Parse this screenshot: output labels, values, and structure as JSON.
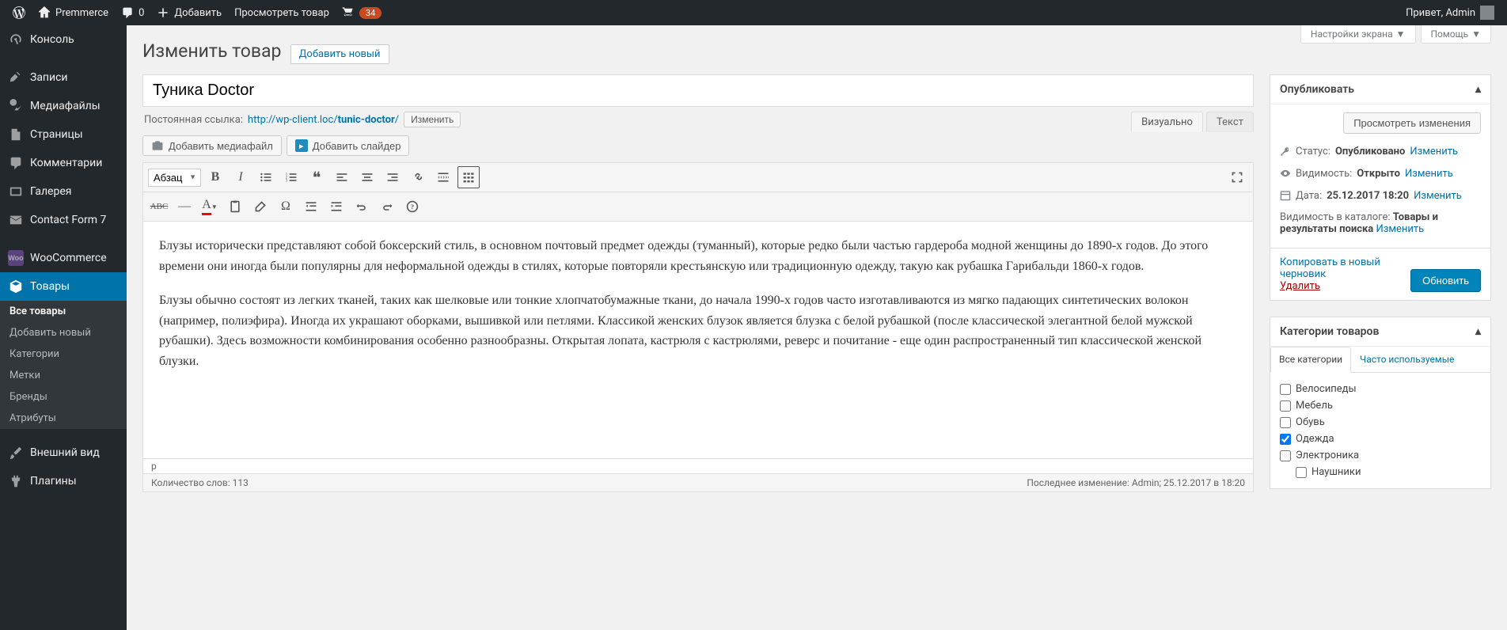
{
  "adminbar": {
    "site_name": "Premmerce",
    "comments_count": "0",
    "add_new": "Добавить",
    "view_item": "Просмотреть товар",
    "updates_count": "34",
    "greeting": "Привет, Admin"
  },
  "screen_options": "Настройки экрана",
  "help": "Помощь",
  "sidebar": {
    "items": [
      {
        "label": "Консоль"
      },
      {
        "label": "Записи"
      },
      {
        "label": "Медиафайлы"
      },
      {
        "label": "Страницы"
      },
      {
        "label": "Комментарии"
      },
      {
        "label": "Галерея"
      },
      {
        "label": "Contact Form 7"
      },
      {
        "label": "WooCommerce"
      },
      {
        "label": "Товары"
      },
      {
        "label": "Внешний вид"
      },
      {
        "label": "Плагины"
      }
    ],
    "submenu": [
      "Все товары",
      "Добавить новый",
      "Категории",
      "Метки",
      "Бренды",
      "Атрибуты"
    ]
  },
  "page": {
    "title": "Изменить товар",
    "add_new": "Добавить новый"
  },
  "post": {
    "title": "Туника Doctor",
    "permalink_label": "Постоянная ссылка:",
    "permalink_base": "http://wp-client.loc/",
    "permalink_slug": "tunic-doctor",
    "permalink_trail": "/",
    "edit": "Изменить",
    "add_media": "Добавить медиафайл",
    "add_slider": "Добавить слайдер",
    "tab_visual": "Визуально",
    "tab_text": "Текст",
    "format_select": "Абзац",
    "body_p1": "Блузы исторически представляют собой боксерский стиль, в основном почтовый предмет одежды (туманный), которые редко были частью гардероба модной женщины до 1890-х годов. До этого времени они иногда были популярны для неформальной одежды в стилях, которые повторяли крестьянскую или традиционную одежду, такую как рубашка Гарибальди 1860-х годов.",
    "body_p2": "Блузы обычно состоят из легких тканей, таких как шелковые или тонкие хлопчатобумажные ткани, до начала 1990-х годов часто изготавливаются из мягко падающих синтетических волокон (например, полиэфира). Иногда их украшают оборками, вышивкой или петлями. Классикой женских блузок является блузка с белой рубашкой (после классической элегантной белой мужской рубашки). Здесь возможности комбинирования особенно разнообразны. Открытая лопата, кастрюля с кастрюлями, реверс и почитание - еще один распространенный тип классической женской блузки.",
    "path": "p",
    "word_count_label": "Количество слов:",
    "word_count": "113",
    "last_edit_label": "Последнее изменение:",
    "last_edit": "Admin; 25.12.2017 в 18:20"
  },
  "publish": {
    "title": "Опубликовать",
    "preview": "Просмотреть изменения",
    "status_label": "Статус:",
    "status_value": "Опубликовано",
    "visibility_label": "Видимость:",
    "visibility_value": "Открыто",
    "date_label": "Дата:",
    "date_value": "25.12.2017 18:20",
    "catalog_label": "Видимость в каталоге:",
    "catalog_value": "Товары и результаты поиска",
    "edit_link": "Изменить",
    "copy_draft": "Копировать в новый черновик",
    "trash": "Удалить",
    "update": "Обновить"
  },
  "categories": {
    "title": "Категории товаров",
    "tab_all": "Все категории",
    "tab_popular": "Часто используемые",
    "items": [
      {
        "label": "Велосипеды",
        "checked": false,
        "child": false
      },
      {
        "label": "Мебель",
        "checked": false,
        "child": false
      },
      {
        "label": "Обувь",
        "checked": false,
        "child": false
      },
      {
        "label": "Одежда",
        "checked": true,
        "child": false
      },
      {
        "label": "Электроника",
        "checked": false,
        "child": false
      },
      {
        "label": "Наушники",
        "checked": false,
        "child": true
      }
    ]
  }
}
